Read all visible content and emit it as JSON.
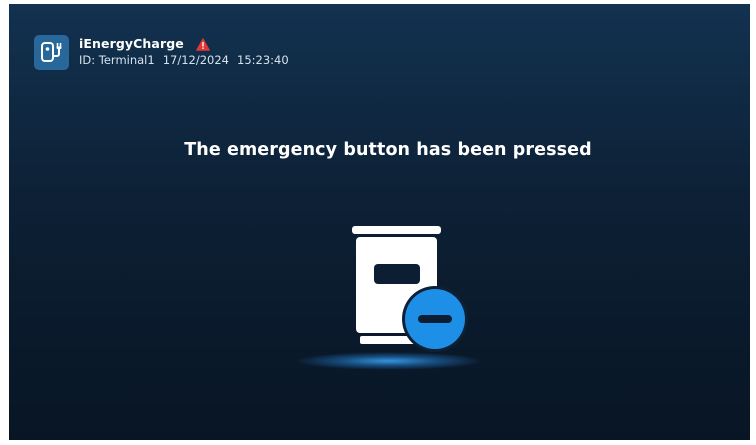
{
  "header": {
    "logo_icon": "ev-charger-icon",
    "brand": "iEnergyCharge",
    "warning_icon": "warning-triangle-icon",
    "warning_color": "#e0363a",
    "terminal_id": "ID: Terminal1",
    "date": "17/12/2024",
    "time": "15:23:40"
  },
  "main": {
    "message": "The emergency button has been pressed",
    "illustration_icon": "charger-stopped-icon",
    "accent_color": "#1e8fe6"
  }
}
